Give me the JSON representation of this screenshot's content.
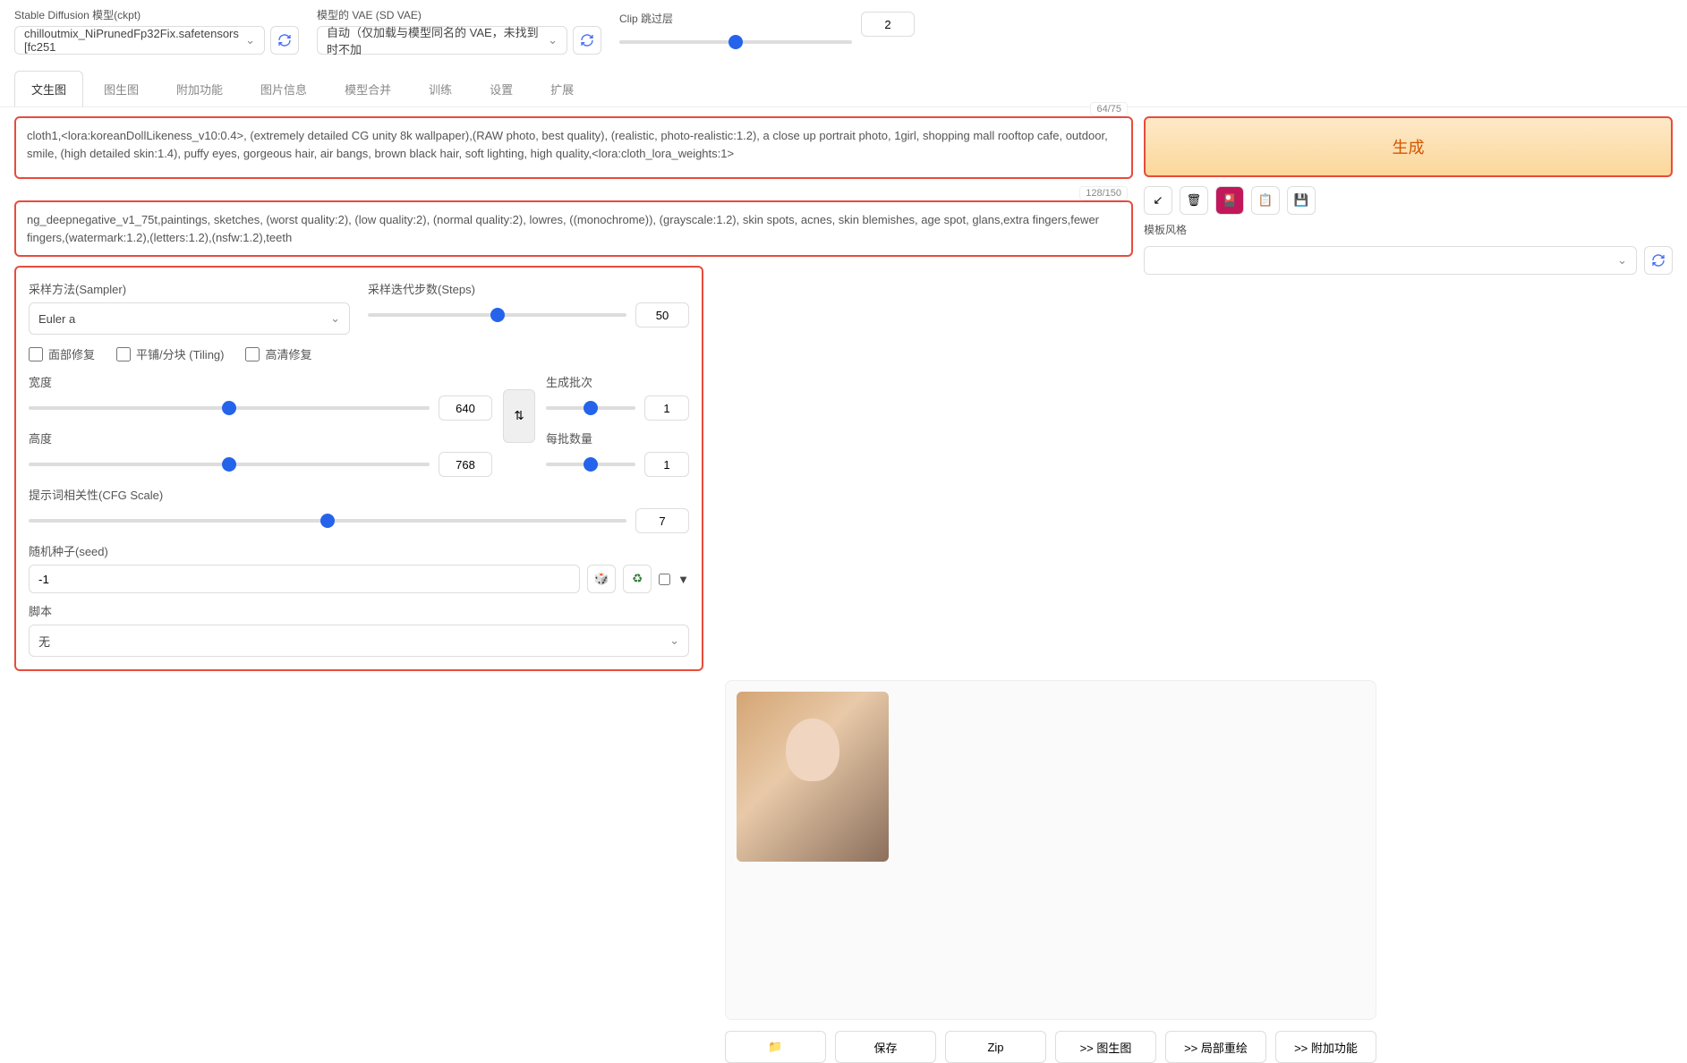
{
  "header": {
    "checkpoint_label": "Stable Diffusion 模型(ckpt)",
    "checkpoint_value": "chilloutmix_NiPrunedFp32Fix.safetensors [fc251",
    "vae_label": "模型的 VAE (SD VAE)",
    "vae_value": "自动（仅加载与模型同名的 VAE，未找到时不加",
    "clip_label": "Clip 跳过层",
    "clip_value": "2"
  },
  "tabs": [
    "文生图",
    "图生图",
    "附加功能",
    "图片信息",
    "模型合并",
    "训练",
    "设置",
    "扩展"
  ],
  "prompt": {
    "counter": "64/75",
    "text": "cloth1,<lora:koreanDollLikeness_v10:0.4>, (extremely detailed CG unity 8k wallpaper),(RAW photo, best quality), (realistic, photo-realistic:1.2), a close up portrait photo, 1girl, shopping mall rooftop cafe, outdoor, smile, (high detailed skin:1.4), puffy eyes, gorgeous hair, air bangs, brown black hair, soft lighting, high quality,<lora:cloth_lora_weights:1>"
  },
  "neg_prompt": {
    "counter": "128/150",
    "text": "ng_deepnegative_v1_75t,paintings, sketches, (worst quality:2), (low quality:2), (normal quality:2), lowres, ((monochrome)), (grayscale:1.2), skin spots, acnes, skin blemishes, age spot, glans,extra fingers,fewer fingers,(watermark:1.2),(letters:1.2),(nsfw:1.2),teeth"
  },
  "generate_label": "生成",
  "style_label": "模板风格",
  "sampler": {
    "label": "采样方法(Sampler)",
    "value": "Euler a"
  },
  "steps": {
    "label": "采样迭代步数(Steps)",
    "value": "50"
  },
  "checks": {
    "face": "面部修复",
    "tiling": "平铺/分块 (Tiling)",
    "hires": "高清修复"
  },
  "width": {
    "label": "宽度",
    "value": "640"
  },
  "height": {
    "label": "高度",
    "value": "768"
  },
  "batch_count": {
    "label": "生成批次",
    "value": "1"
  },
  "batch_size": {
    "label": "每批数量",
    "value": "1"
  },
  "cfg": {
    "label": "提示词相关性(CFG Scale)",
    "value": "7"
  },
  "seed": {
    "label": "随机种子(seed)",
    "value": "-1"
  },
  "script": {
    "label": "脚本",
    "value": "无"
  },
  "actions": {
    "save": "保存",
    "zip": "Zip",
    "img2img": ">> 图生图",
    "inpaint": ">> 局部重绘",
    "extras": ">> 附加功能"
  }
}
